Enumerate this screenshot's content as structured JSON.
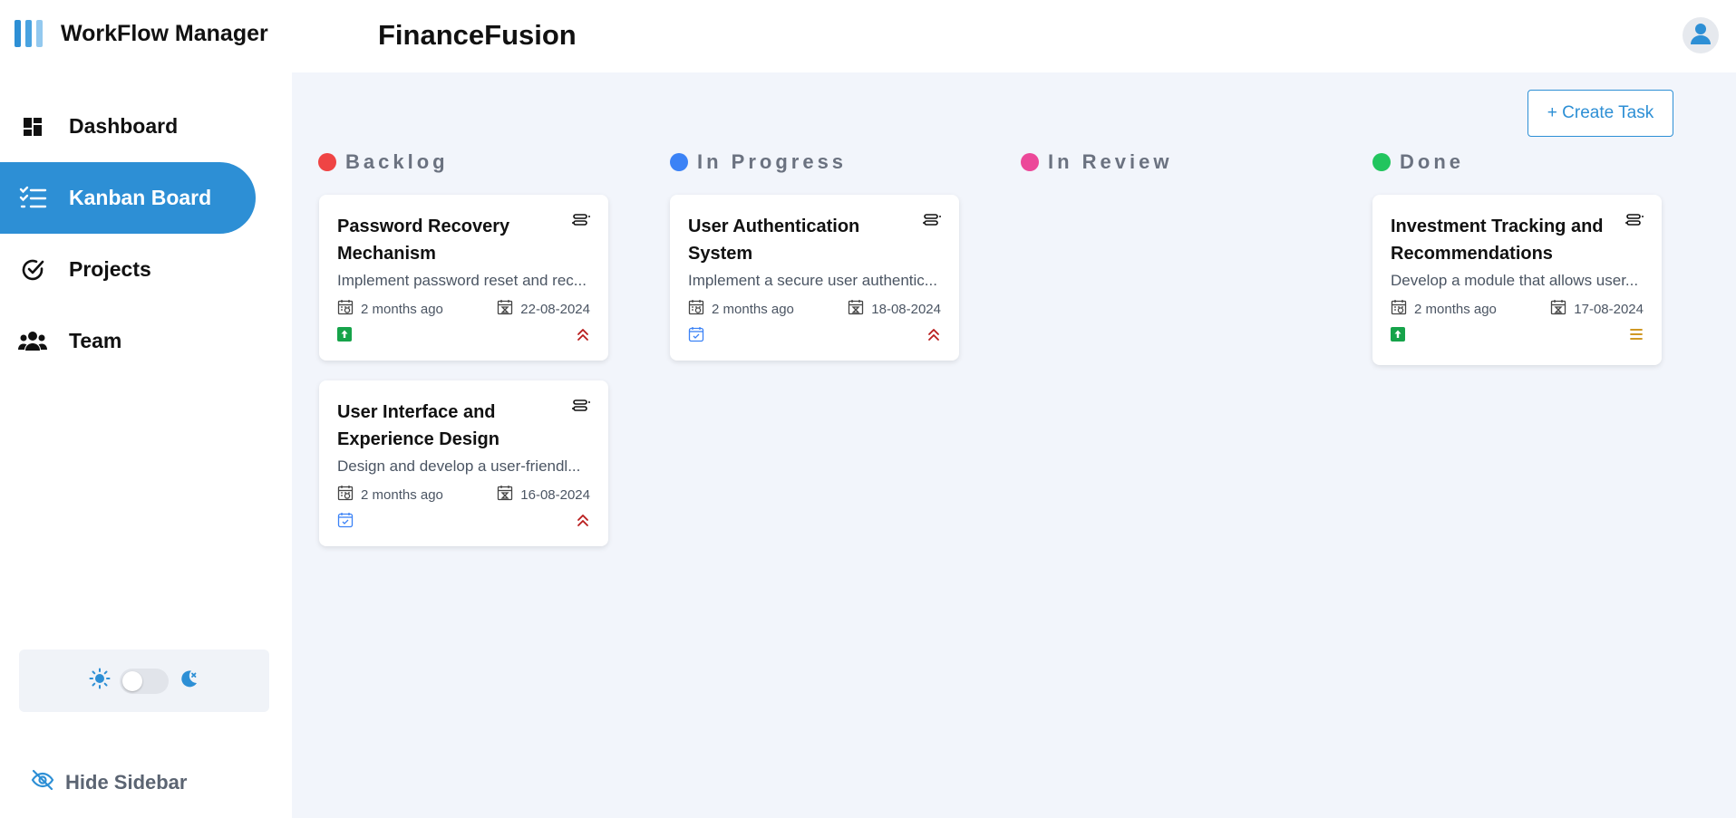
{
  "sidebar": {
    "brand_title": "WorkFlow Manager",
    "items": [
      {
        "label": "Dashboard",
        "icon": "dashboard-icon"
      },
      {
        "label": "Kanban Board",
        "icon": "checklist-icon",
        "active": true
      },
      {
        "label": "Projects",
        "icon": "check-circle-icon"
      },
      {
        "label": "Team",
        "icon": "users-icon"
      }
    ],
    "hide_label": "Hide Sidebar"
  },
  "header": {
    "app_title": "FinanceFusion"
  },
  "toolbar": {
    "create_label": "+ Create Task"
  },
  "columns": [
    {
      "title": "Backlog",
      "color": "#ef4444"
    },
    {
      "title": "In Progress",
      "color": "#3b82f6"
    },
    {
      "title": "In Review",
      "color": "#ec4899"
    },
    {
      "title": "Done",
      "color": "#22c55e"
    }
  ],
  "cards": [
    {
      "column": "Backlog",
      "title": "Password Recovery Mechanism",
      "desc": "Implement password reset and rec...",
      "created": "2 months ago",
      "due": "22-08-2024",
      "type_icon": "arrow-up-square-icon",
      "priority_icon": "double-chevron-up-icon"
    },
    {
      "column": "Backlog",
      "title": "User Interface and Experience Design",
      "desc": "Design and develop a user-friendl...",
      "created": "2 months ago",
      "due": "16-08-2024",
      "type_icon": "calendar-check-icon",
      "priority_icon": "double-chevron-up-icon"
    },
    {
      "column": "In Progress",
      "title": "User Authentication System",
      "desc": "Implement a secure user authentic...",
      "created": "2 months ago",
      "due": "18-08-2024",
      "type_icon": "calendar-check-icon",
      "priority_icon": "double-chevron-up-icon"
    },
    {
      "column": "Done",
      "title": "Investment Tracking and Recommendations",
      "desc": "Develop a module that allows user...",
      "created": "2 months ago",
      "due": "17-08-2024",
      "type_icon": "arrow-up-square-icon",
      "priority_icon": "equals-lines-icon"
    }
  ],
  "colors": {
    "accent": "#2d8fd5",
    "priority_high": "#b91c1c",
    "priority_medium": "#ca8a04",
    "story": "#16a34a",
    "background": "#f2f5fb"
  }
}
